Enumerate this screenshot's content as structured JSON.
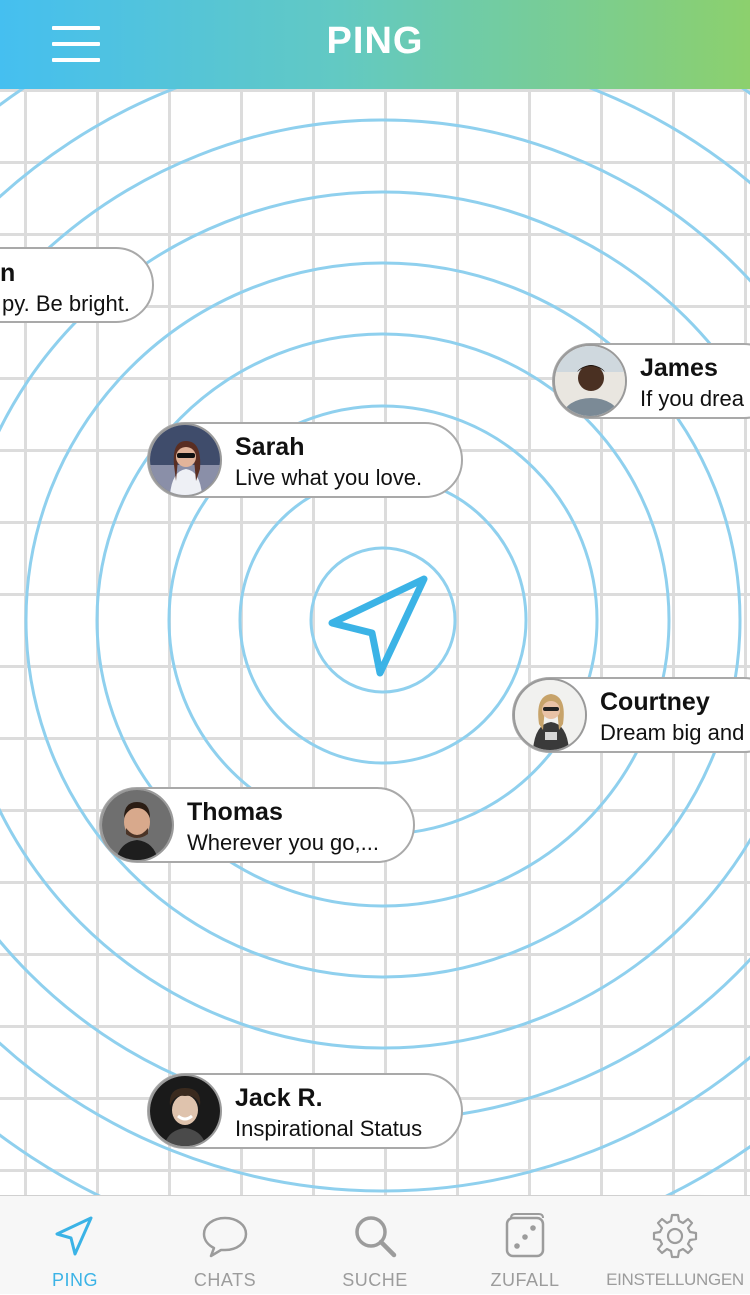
{
  "header": {
    "title": "PING",
    "menu_icon": "hamburger-menu-icon"
  },
  "map": {
    "center_icon": "navigation-arrow-icon",
    "locate_icon": "crosshair-target-icon",
    "colors": {
      "ring": "#8fd0ee",
      "grid": "#dcdcdc",
      "accent": "#3bb3e6"
    }
  },
  "users": [
    {
      "name": "n",
      "status": "py. Be bright."
    },
    {
      "name": "James",
      "status": "If you drea"
    },
    {
      "name": "Sarah",
      "status": "Live what you love."
    },
    {
      "name": "Courtney",
      "status": "Dream big and"
    },
    {
      "name": "Thomas",
      "status": "Wherever you go,..."
    },
    {
      "name": "Jack R.",
      "status": "Inspirational Status"
    }
  ],
  "tabs": [
    {
      "label": "PING",
      "icon": "navigation-arrow-icon",
      "active": true
    },
    {
      "label": "CHATS",
      "icon": "chat-bubble-icon",
      "active": false
    },
    {
      "label": "SUCHE",
      "icon": "search-icon",
      "active": false
    },
    {
      "label": "ZUFALL",
      "icon": "dice-icon",
      "active": false
    },
    {
      "label": "EINSTELLUNGEN",
      "icon": "gear-icon",
      "active": false
    }
  ]
}
